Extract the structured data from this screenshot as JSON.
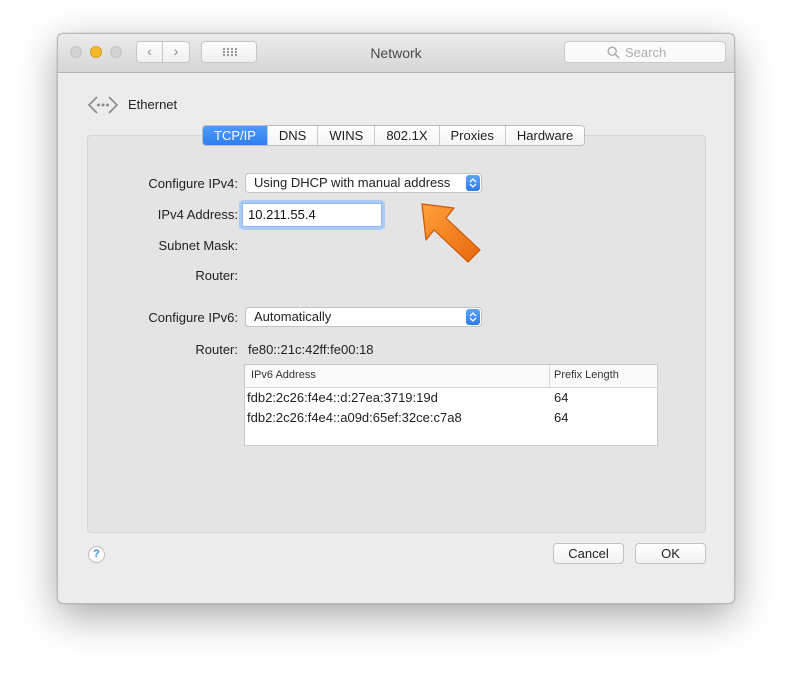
{
  "window": {
    "title": "Network",
    "search_placeholder": "Search"
  },
  "service": {
    "name": "Ethernet"
  },
  "tabs": [
    {
      "label": "TCP/IP",
      "active": true
    },
    {
      "label": "DNS",
      "active": false
    },
    {
      "label": "WINS",
      "active": false
    },
    {
      "label": "802.1X",
      "active": false
    },
    {
      "label": "Proxies",
      "active": false
    },
    {
      "label": "Hardware",
      "active": false
    }
  ],
  "ipv4": {
    "configure_label": "Configure IPv4:",
    "configure_value": "Using DHCP with manual address",
    "address_label": "IPv4 Address:",
    "address_value": "10.211.55.4",
    "subnet_label": "Subnet Mask:",
    "router_label": "Router:"
  },
  "ipv6": {
    "configure_label": "Configure IPv6:",
    "configure_value": "Automatically",
    "router_label": "Router:",
    "router_value": "fe80::21c:42ff:fe00:18",
    "table": {
      "columns": [
        "IPv6 Address",
        "Prefix Length"
      ],
      "rows": [
        [
          "fdb2:2c26:f4e4::d:27ea:3719:19d",
          "64"
        ],
        [
          "fdb2:2c26:f4e4::a09d:65ef:32ce:c7a8",
          "64"
        ]
      ]
    }
  },
  "buttons": {
    "help": "?",
    "cancel": "Cancel",
    "ok": "OK"
  },
  "colors": {
    "accent": "#2f7ef0",
    "annotation_arrow": "#f07d1a"
  }
}
